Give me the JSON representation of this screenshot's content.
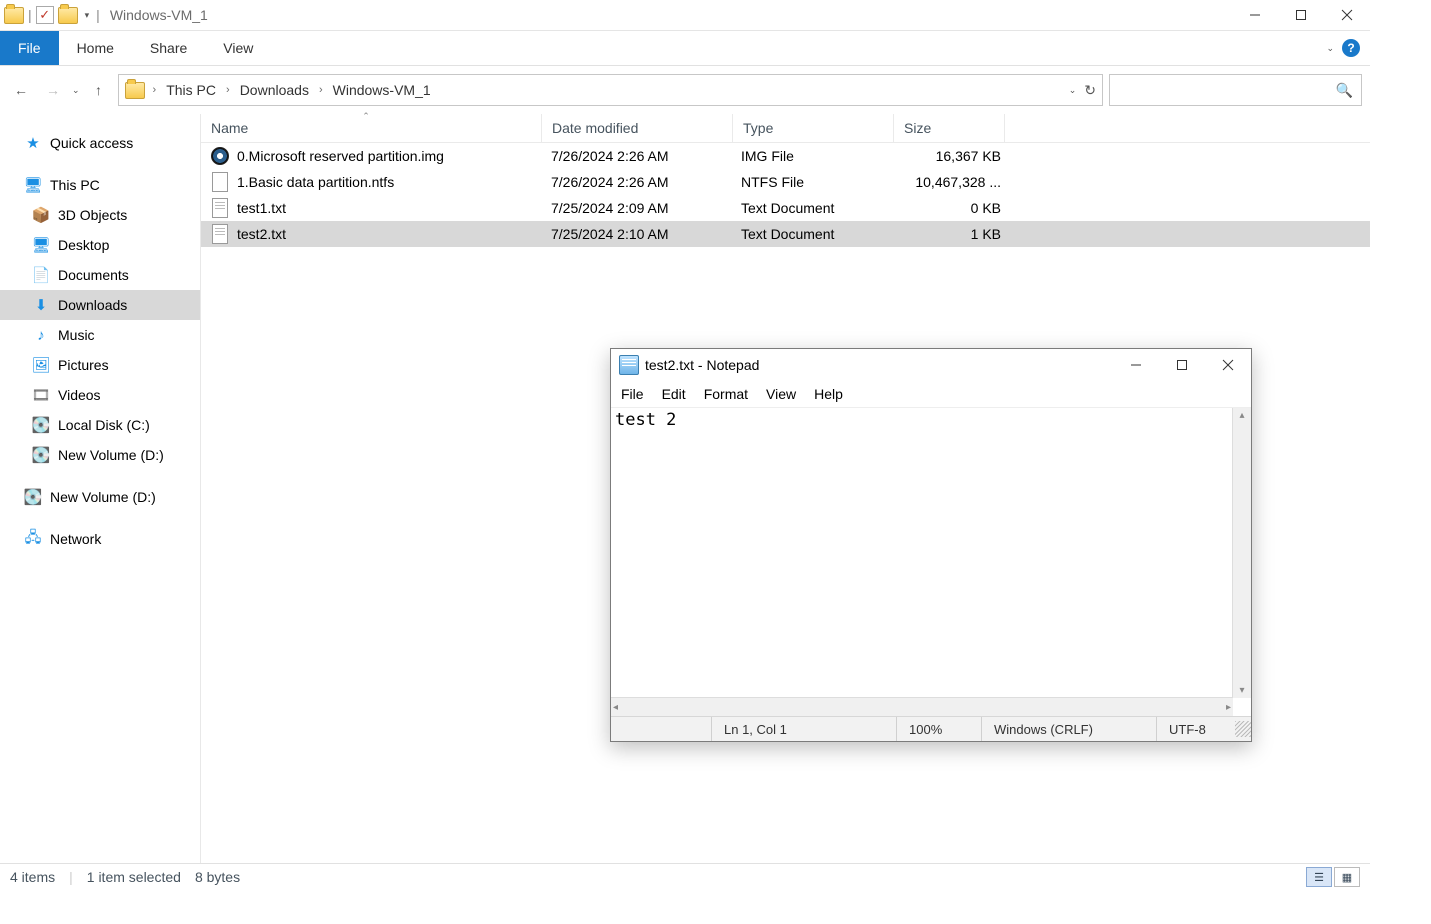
{
  "explorer": {
    "title": "Windows-VM_1",
    "tabs": {
      "file": "File",
      "home": "Home",
      "share": "Share",
      "view": "View"
    },
    "breadcrumb": [
      "This PC",
      "Downloads",
      "Windows-VM_1"
    ],
    "search_placeholder": "",
    "columns": {
      "name": "Name",
      "date": "Date modified",
      "type": "Type",
      "size": "Size"
    },
    "nav": {
      "quick": "Quick access",
      "thispc": "This PC",
      "items": [
        "3D Objects",
        "Desktop",
        "Documents",
        "Downloads",
        "Music",
        "Pictures",
        "Videos",
        "Local Disk (C:)",
        "New Volume (D:)"
      ],
      "extra": "New Volume (D:)",
      "network": "Network"
    },
    "files": [
      {
        "name": "0.Microsoft reserved partition.img",
        "date": "7/26/2024 2:26 AM",
        "type": "IMG File",
        "size": "16,367 KB",
        "icon": "disk"
      },
      {
        "name": "1.Basic data partition.ntfs",
        "date": "7/26/2024 2:26 AM",
        "type": "NTFS File",
        "size": "10,467,328 ...",
        "icon": "blank"
      },
      {
        "name": "test1.txt",
        "date": "7/25/2024 2:09 AM",
        "type": "Text Document",
        "size": "0 KB",
        "icon": "text"
      },
      {
        "name": "test2.txt",
        "date": "7/25/2024 2:10 AM",
        "type": "Text Document",
        "size": "1 KB",
        "icon": "text",
        "selected": true
      }
    ],
    "status": {
      "count": "4 items",
      "selection": "1 item selected",
      "bytes": "8 bytes"
    }
  },
  "notepad": {
    "title": "test2.txt - Notepad",
    "menu": [
      "File",
      "Edit",
      "Format",
      "View",
      "Help"
    ],
    "content": "test 2",
    "status": {
      "pos": "Ln 1, Col 1",
      "zoom": "100%",
      "eol": "Windows (CRLF)",
      "enc": "UTF-8"
    }
  }
}
